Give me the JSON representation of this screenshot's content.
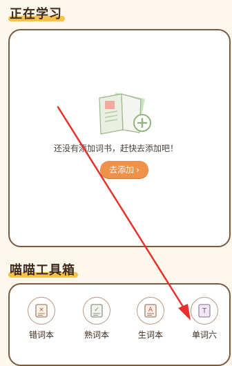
{
  "sections": {
    "studying_title": "正在学习",
    "tools_title": "喵喵工具箱"
  },
  "empty_state": {
    "message": "还没有添加词书，赶快去添加吧！",
    "button_label": "去添加",
    "button_chevron": "›"
  },
  "tools": [
    {
      "label": "错词本",
      "icon": "wrong-words-icon",
      "glyph": "×"
    },
    {
      "label": "熟词本",
      "icon": "known-words-icon",
      "glyph": "✓"
    },
    {
      "label": "生词本",
      "icon": "new-words-icon",
      "glyph": "A"
    },
    {
      "label": "单词六",
      "icon": "word-book-icon",
      "glyph": "T"
    }
  ],
  "colors": {
    "background": "#fdf7ec",
    "accent_orange": "#f0914a",
    "title_highlight": "#f6c24a",
    "card_border": "#7a5a3e",
    "arrow_red": "#e8302a"
  }
}
